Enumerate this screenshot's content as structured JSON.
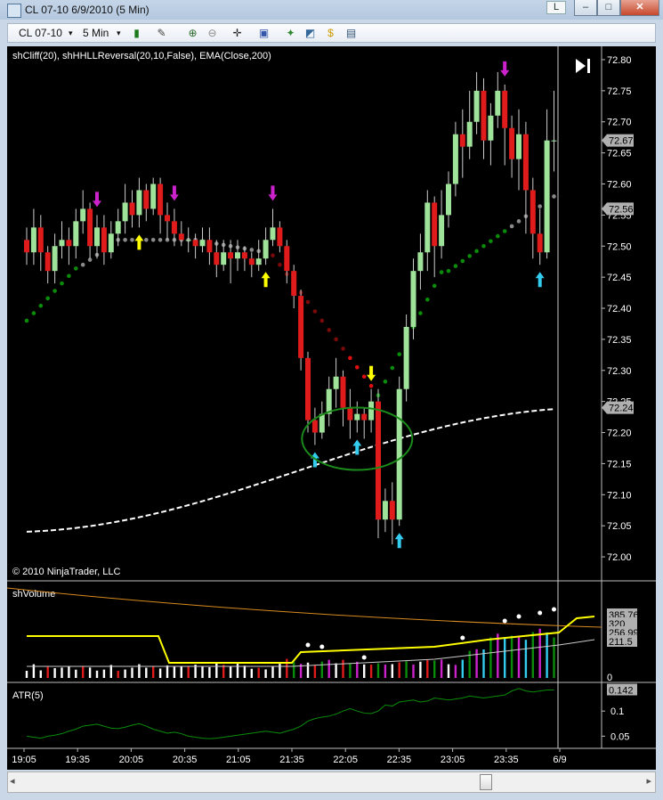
{
  "window": {
    "title": "CL 07-10  6/9/2010 (5 Min)",
    "button_l": "L",
    "button_min": "–",
    "button_max": "□",
    "button_close": "✕"
  },
  "toolbar": {
    "instrument": "CL 07-10",
    "interval": "5 Min"
  },
  "indicators_label": "shCliff(20), shHHLLReversal(20,10,False), EMA(Close,200)",
  "copyright": "© 2010 NinjaTrader, LLC",
  "colors": {
    "up_candle": "#9fe39a",
    "down_candle": "#e01b1b",
    "ema": "#ffffff",
    "cliff_dark_green": "#0a8c0a",
    "cliff_gray": "#8a8a8a",
    "cliff_dark_red": "#7a0a0a",
    "cliff_red": "#e01010",
    "volume_yellow": "#ffff00",
    "volume_orange": "#d88a20",
    "highlight_ellipse": "#1a8a1a"
  },
  "chart_data": [
    {
      "type": "candlestick",
      "panel": "price",
      "ylim": [
        71.97,
        72.81
      ],
      "y_ticks": [
        "72.80",
        "72.75",
        "72.70",
        "72.65",
        "72.60",
        "72.55",
        "72.50",
        "72.45",
        "72.40",
        "72.35",
        "72.30",
        "72.25",
        "72.20",
        "72.15",
        "72.10",
        "72.05",
        "72.00"
      ],
      "x_ticks": [
        "19:05",
        "19:35",
        "20:05",
        "20:35",
        "21:05",
        "21:35",
        "22:05",
        "22:35",
        "23:05",
        "23:35",
        "6/9"
      ],
      "value_tags": [
        {
          "label": "72.67",
          "value": 72.67
        },
        {
          "label": "72.56",
          "value": 72.56
        },
        {
          "label": "72.24",
          "value": 72.24
        }
      ],
      "candles": [
        [
          72.51,
          72.49,
          72.53,
          72.47
        ],
        [
          72.49,
          72.53,
          72.56,
          72.47
        ],
        [
          72.53,
          72.49,
          72.55,
          72.46
        ],
        [
          72.49,
          72.46,
          72.5,
          72.44
        ],
        [
          72.46,
          72.5,
          72.52,
          72.44
        ],
        [
          72.5,
          72.51,
          72.54,
          72.48
        ],
        [
          72.51,
          72.5,
          72.53,
          72.47
        ],
        [
          72.5,
          72.54,
          72.56,
          72.48
        ],
        [
          72.54,
          72.56,
          72.59,
          72.52
        ],
        [
          72.56,
          72.5,
          72.57,
          72.48
        ],
        [
          72.5,
          72.53,
          72.55,
          72.48
        ],
        [
          72.53,
          72.49,
          72.55,
          72.47
        ],
        [
          72.49,
          72.52,
          72.54,
          72.48
        ],
        [
          72.52,
          72.54,
          72.56,
          72.5
        ],
        [
          72.54,
          72.57,
          72.6,
          72.52
        ],
        [
          72.57,
          72.55,
          72.59,
          72.53
        ],
        [
          72.55,
          72.59,
          72.61,
          72.53
        ],
        [
          72.59,
          72.56,
          72.6,
          72.54
        ],
        [
          72.56,
          72.6,
          72.61,
          72.55
        ],
        [
          72.6,
          72.55,
          72.61,
          72.52
        ],
        [
          72.55,
          72.54,
          72.57,
          72.51
        ],
        [
          72.54,
          72.52,
          72.56,
          72.5
        ],
        [
          72.52,
          72.51,
          72.54,
          72.5
        ],
        [
          72.51,
          72.51,
          72.53,
          72.49
        ],
        [
          72.51,
          72.5,
          72.52,
          72.48
        ],
        [
          72.5,
          72.51,
          72.53,
          72.49
        ],
        [
          72.51,
          72.49,
          72.53,
          72.47
        ],
        [
          72.49,
          72.47,
          72.51,
          72.45
        ],
        [
          72.47,
          72.49,
          72.51,
          72.46
        ],
        [
          72.49,
          72.48,
          72.51,
          72.44
        ],
        [
          72.48,
          72.49,
          72.51,
          72.46
        ],
        [
          72.49,
          72.48,
          72.5,
          72.46
        ],
        [
          72.48,
          72.47,
          72.49,
          72.45
        ],
        [
          72.47,
          72.48,
          72.51,
          72.46
        ],
        [
          72.48,
          72.51,
          72.53,
          72.47
        ],
        [
          72.51,
          72.53,
          72.56,
          72.5
        ],
        [
          72.53,
          72.5,
          72.54,
          72.49
        ],
        [
          72.5,
          72.46,
          72.51,
          72.44
        ],
        [
          72.46,
          72.42,
          72.47,
          72.4
        ],
        [
          72.42,
          72.32,
          72.43,
          72.3
        ],
        [
          72.32,
          72.22,
          72.33,
          72.2
        ],
        [
          72.22,
          72.2,
          72.24,
          72.18
        ],
        [
          72.2,
          72.23,
          72.25,
          72.19
        ],
        [
          72.23,
          72.27,
          72.29,
          72.21
        ],
        [
          72.27,
          72.29,
          72.32,
          72.24
        ],
        [
          72.29,
          72.24,
          72.3,
          72.21
        ],
        [
          72.24,
          72.22,
          72.27,
          72.19
        ],
        [
          72.22,
          72.23,
          72.25,
          72.2
        ],
        [
          72.23,
          72.22,
          72.24,
          72.19
        ],
        [
          72.22,
          72.25,
          72.27,
          72.2
        ],
        [
          72.25,
          72.06,
          72.27,
          72.03
        ],
        [
          72.06,
          72.09,
          72.11,
          72.04
        ],
        [
          72.09,
          72.06,
          72.12,
          72.02
        ],
        [
          72.06,
          72.27,
          72.29,
          72.05
        ],
        [
          72.27,
          72.37,
          72.39,
          72.25
        ],
        [
          72.37,
          72.46,
          72.48,
          72.35
        ],
        [
          72.46,
          72.49,
          72.52,
          72.43
        ],
        [
          72.49,
          72.57,
          72.59,
          72.46
        ],
        [
          72.57,
          72.5,
          72.58,
          72.45
        ],
        [
          72.5,
          72.55,
          72.59,
          72.48
        ],
        [
          72.55,
          72.6,
          72.62,
          72.53
        ],
        [
          72.6,
          72.68,
          72.7,
          72.58
        ],
        [
          72.68,
          72.66,
          72.72,
          72.61
        ],
        [
          72.66,
          72.7,
          72.75,
          72.64
        ],
        [
          72.7,
          72.75,
          72.78,
          72.68
        ],
        [
          72.75,
          72.67,
          72.77,
          72.64
        ],
        [
          72.67,
          72.71,
          72.73,
          72.63
        ],
        [
          72.71,
          72.75,
          72.78,
          72.69
        ],
        [
          72.75,
          72.69,
          72.76,
          72.63
        ],
        [
          72.69,
          72.64,
          72.71,
          72.61
        ],
        [
          72.64,
          72.68,
          72.72,
          72.59
        ],
        [
          72.68,
          72.59,
          72.7,
          72.52
        ],
        [
          72.59,
          72.52,
          72.61,
          72.48
        ],
        [
          72.52,
          72.49,
          72.56,
          72.47
        ],
        [
          72.49,
          72.67,
          72.72,
          72.48
        ],
        [
          72.67,
          72.67,
          72.75,
          72.62
        ]
      ],
      "ema_200": {
        "start": 72.04,
        "end": 72.24
      },
      "arrows": [
        {
          "bar": 10,
          "dir": "down",
          "color": "#cc22cc"
        },
        {
          "bar": 16,
          "dir": "up",
          "color": "#ffff00"
        },
        {
          "bar": 21,
          "dir": "down",
          "color": "#cc22cc"
        },
        {
          "bar": 34,
          "dir": "up",
          "color": "#ffff00"
        },
        {
          "bar": 35,
          "dir": "down",
          "color": "#cc22cc"
        },
        {
          "bar": 41,
          "dir": "up",
          "color": "#33ccee"
        },
        {
          "bar": 47,
          "dir": "up",
          "color": "#33ccee"
        },
        {
          "bar": 49,
          "dir": "down",
          "color": "#ffff00"
        },
        {
          "bar": 53,
          "dir": "up",
          "color": "#33ccee"
        },
        {
          "bar": 68,
          "dir": "down",
          "color": "#cc22cc"
        },
        {
          "bar": 73,
          "dir": "up",
          "color": "#33ccee"
        }
      ]
    },
    {
      "type": "bar",
      "panel": "volume",
      "title": "shVolume",
      "y_ticks": [
        "0"
      ],
      "value_tags": [
        "385.76",
        "320",
        "256.99",
        "211.5"
      ]
    },
    {
      "type": "line",
      "panel": "atr",
      "title": "ATR(5)",
      "y_ticks": [
        "0.1",
        "0.05"
      ],
      "value_tags": [
        "0.142"
      ],
      "values": [
        0.05,
        0.048,
        0.046,
        0.05,
        0.052,
        0.055,
        0.06,
        0.064,
        0.07,
        0.072,
        0.074,
        0.07,
        0.066,
        0.065,
        0.068,
        0.072,
        0.075,
        0.07,
        0.064,
        0.06,
        0.056,
        0.058,
        0.055,
        0.05,
        0.048,
        0.046,
        0.045,
        0.046,
        0.048,
        0.05,
        0.052,
        0.054,
        0.056,
        0.058,
        0.06,
        0.058,
        0.056,
        0.06,
        0.064,
        0.07,
        0.08,
        0.085,
        0.088,
        0.09,
        0.094,
        0.1,
        0.105,
        0.1,
        0.096,
        0.095,
        0.1,
        0.112,
        0.11,
        0.118,
        0.12,
        0.122,
        0.118,
        0.12,
        0.126,
        0.124,
        0.122,
        0.124,
        0.126,
        0.13,
        0.128,
        0.126,
        0.128,
        0.13,
        0.132,
        0.14,
        0.145,
        0.14,
        0.138,
        0.14,
        0.142,
        0.142
      ]
    }
  ]
}
